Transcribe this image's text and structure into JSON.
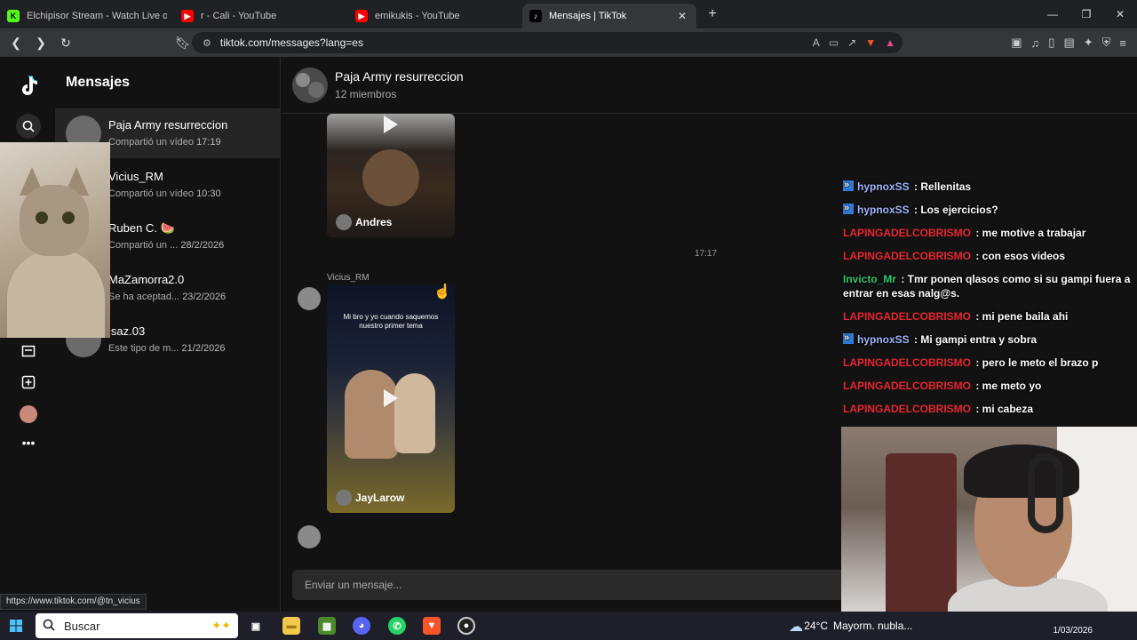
{
  "browser": {
    "tabs": [
      {
        "title": "Elchipisor Stream - Watch Live on",
        "icon": "kick-icon",
        "color": "#53fc18"
      },
      {
        "title": "r - Cali - YouTube",
        "icon": "youtube-icon",
        "color": "#ff0000"
      },
      {
        "title": "emikukis - YouTube",
        "icon": "youtube-icon",
        "color": "#ff0000"
      },
      {
        "title": "Mensajes | TikTok",
        "icon": "tiktok-icon",
        "color": "#000000",
        "active": true
      }
    ],
    "url": "tiktok.com/messages?lang=es"
  },
  "sidebar": {
    "title": "Mensajes"
  },
  "conversations": [
    {
      "name": "Paja Army resurreccion",
      "preview": "Compartió un vídeo",
      "time": "17:19",
      "selected": true
    },
    {
      "name": "Vicius_RM",
      "preview": "Compartió un vídeo",
      "time": "10:30"
    },
    {
      "name": "Ruben C. 🍉",
      "preview": "Compartió un ...",
      "time": "28/2/2026"
    },
    {
      "name": "MaZamorra2.0",
      "preview": "Se ha aceptad...",
      "time": "23/2/2026"
    },
    {
      "name": "jsaz.03",
      "preview": "Este tipo de m...",
      "time": "21/2/2026"
    }
  ],
  "chat": {
    "group_name": "Paja Army resurreccion",
    "members": "12 miembros",
    "video1_author": "Andres",
    "timestamp": "17:17",
    "sender": "Vicius_RM",
    "video2_caption": "Mi bro y yo cuando saquemos nuestro primer tema",
    "video2_author": "JayLarow",
    "input_placeholder": "Enviar un mensaje..."
  },
  "stream_chat": [
    {
      "user": "hypnoxSS",
      "text": " : Rellenitas",
      "color": "#9fb7ff",
      "badge": true
    },
    {
      "user": "hypnoxSS",
      "text": " : Los ejercicios?",
      "color": "#9fb7ff",
      "badge": true
    },
    {
      "user": "LAPINGADELCOBRISMO",
      "text": " : me motive a trabajar",
      "color": "#e8242f",
      "badge": false
    },
    {
      "user": "LAPINGADELCOBRISMO",
      "text": " : con esos videos",
      "color": "#e8242f",
      "badge": false
    },
    {
      "user": "Invicto_Mr",
      "text": " : Tmr ponen qlasos como si su gampi fuera a entrar en esas nalg@s.",
      "color": "#2ecc71",
      "badge": false
    },
    {
      "user": "LAPINGADELCOBRISMO",
      "text": " : mi pene baila ahi",
      "color": "#e8242f",
      "badge": false
    },
    {
      "user": "hypnoxSS",
      "text": " : Mi gampi entra y sobra",
      "color": "#9fb7ff",
      "badge": true
    },
    {
      "user": "LAPINGADELCOBRISMO",
      "text": " : pero le meto el brazo p",
      "color": "#e8242f",
      "badge": false
    },
    {
      "user": "LAPINGADELCOBRISMO",
      "text": " : me meto yo",
      "color": "#e8242f",
      "badge": false
    },
    {
      "user": "LAPINGADELCOBRISMO",
      "text": " : mi cabeza",
      "color": "#e8242f",
      "badge": false
    }
  ],
  "status_url": "https://www.tiktok.com/@tn_vicius",
  "taskbar": {
    "search_label": "Buscar",
    "weather": "24°C",
    "weather_text": "Mayorm. nubla...",
    "date": "1/03/2026"
  }
}
